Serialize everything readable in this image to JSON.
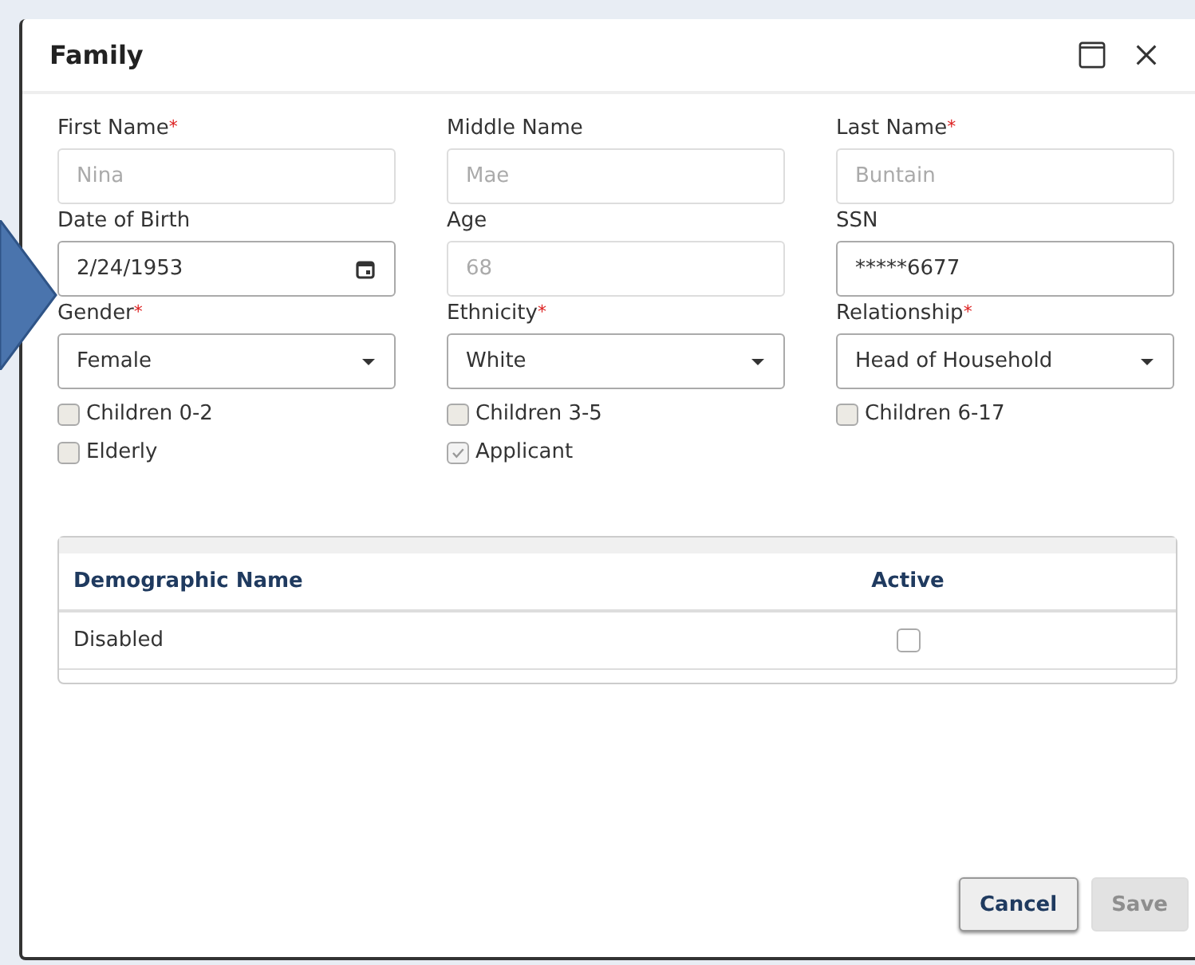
{
  "dialog": {
    "title": "Family"
  },
  "fields": [
    {
      "label": "First Name",
      "required_mark": "*",
      "kind": "text",
      "value": "Nina",
      "disabled": true
    },
    {
      "label": "Middle Name",
      "kind": "text",
      "value": "Mae",
      "disabled": true
    },
    {
      "label": "Last Name",
      "required_mark": "*",
      "kind": "text",
      "value": "Buntain",
      "disabled": true
    },
    {
      "label": "Date of Birth",
      "kind": "date",
      "value": "2/24/1953",
      "disabled": false
    },
    {
      "label": "Age",
      "kind": "text",
      "value": "68",
      "disabled": true
    },
    {
      "label": "SSN",
      "kind": "text",
      "value": "*****6677",
      "disabled": false
    },
    {
      "label": "Gender",
      "required_mark": "*",
      "kind": "select",
      "value": "Female",
      "disabled": false
    },
    {
      "label": "Ethnicity",
      "required_mark": "*",
      "kind": "select",
      "value": "White",
      "disabled": false
    },
    {
      "label": "Relationship",
      "required_mark": "*",
      "kind": "select",
      "value": "Head of Household",
      "disabled": false
    }
  ],
  "checkboxes": [
    {
      "label": "Children 0-2",
      "checked": false
    },
    {
      "label": "Children 3-5",
      "checked": false
    },
    {
      "label": "Children 6-17",
      "checked": false
    },
    {
      "label": "Elderly",
      "checked": false
    },
    {
      "label": "Applicant",
      "checked": true
    }
  ],
  "table": {
    "columns": [
      "Demographic Name",
      "Active"
    ],
    "rows": [
      {
        "name": "Disabled",
        "active": false
      }
    ]
  },
  "buttons": [
    {
      "label": "Cancel",
      "disabled": false
    },
    {
      "label": "Save",
      "disabled": true
    }
  ]
}
